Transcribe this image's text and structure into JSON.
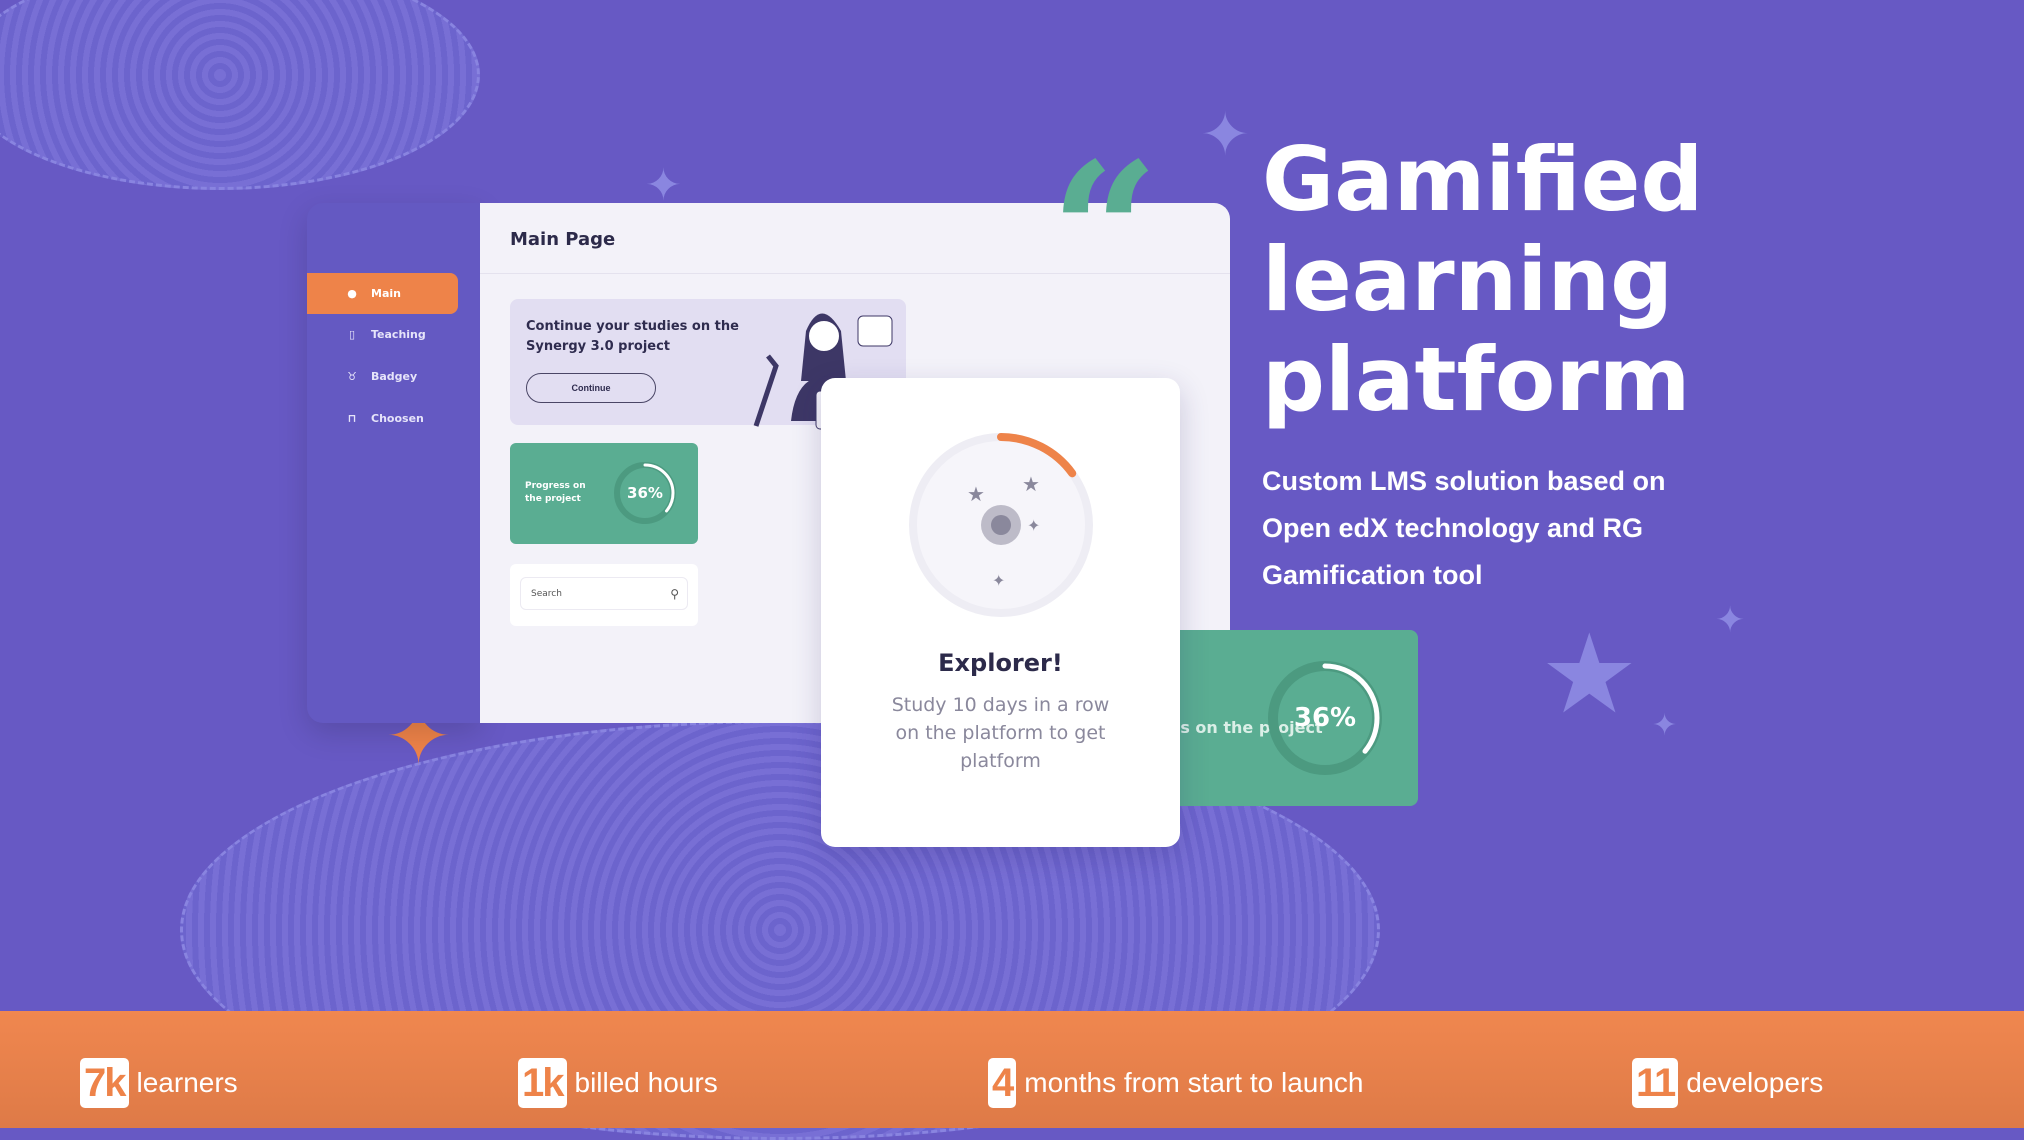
{
  "app": {
    "sidebar": {
      "items": [
        {
          "label": "Main",
          "icon": "compass-icon",
          "active": true
        },
        {
          "label": "Teaching",
          "icon": "book-icon"
        },
        {
          "label": "Badgey",
          "icon": "trophy-icon"
        },
        {
          "label": "Choosen",
          "icon": "bookmark-icon"
        }
      ]
    },
    "main": {
      "title": "Main Page",
      "promo": {
        "text": "Continue your studies on the Synergy 3.0 project",
        "button": "Continue"
      },
      "progress": {
        "label": "Progress on the project",
        "value": "36%",
        "percent": 36
      },
      "search": {
        "placeholder": "Search"
      }
    },
    "badge": {
      "title": "Explorer!",
      "text": "Study 10 days in a row on the platform to get platform",
      "progress_percent": 15
    },
    "big_progress": {
      "label": "Progress on the project",
      "value": "36%",
      "percent": 36
    }
  },
  "hero": {
    "title_lines": [
      "Gamified",
      "learning",
      "platform"
    ],
    "subtitle": "Custom LMS solution based on Open edX technology and RG Gamification tool"
  },
  "stats": [
    {
      "number": "7k",
      "label": "learners"
    },
    {
      "number": "1k",
      "label": "billed hours"
    },
    {
      "number": "4",
      "label": "months from start to launch"
    },
    {
      "number": "11",
      "label": "developers"
    }
  ],
  "colors": {
    "background": "#6759c4",
    "accent": "#ee8349",
    "green": "#5aad92"
  }
}
